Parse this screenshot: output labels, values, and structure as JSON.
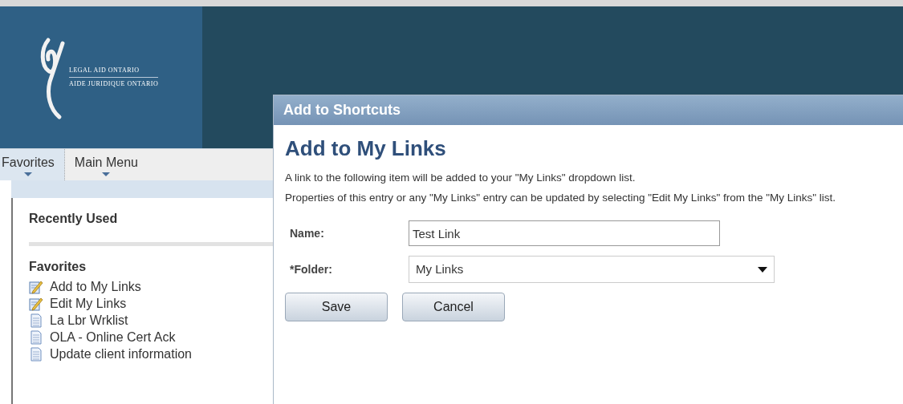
{
  "header": {
    "logo_lines": [
      "LEGAL AID ONTARIO",
      "AIDE JURIDIQUE ONTARIO"
    ]
  },
  "menu_tabs": [
    {
      "label": "Favorites",
      "selected": true
    },
    {
      "label": "Main Menu",
      "selected": false
    }
  ],
  "sidebar": {
    "sections": [
      {
        "title": "Recently Used"
      },
      {
        "title": "Favorites",
        "items": [
          {
            "label": "Add to My Links",
            "kind": "edit"
          },
          {
            "label": "Edit My Links",
            "kind": "edit"
          },
          {
            "label": "La Lbr Wrklist",
            "kind": "page"
          },
          {
            "label": "OLA - Online Cert Ack",
            "kind": "page"
          },
          {
            "label": "Update client information",
            "kind": "page"
          }
        ]
      }
    ]
  },
  "dialog": {
    "title": "Add to Shortcuts",
    "heading": "Add to My Links",
    "description": [
      "A link to the following item will be added to your \"My Links\" dropdown list.",
      "Properties of this entry or any \"My Links\" entry can be updated by selecting \"Edit My Links\" from the \"My Links\" list."
    ],
    "fields": [
      {
        "label": "Name:",
        "kind": "text",
        "value": "Test Link"
      },
      {
        "label": "*Folder:",
        "kind": "select",
        "value": "My Links"
      }
    ],
    "buttons": [
      "Save",
      "Cancel"
    ]
  }
}
